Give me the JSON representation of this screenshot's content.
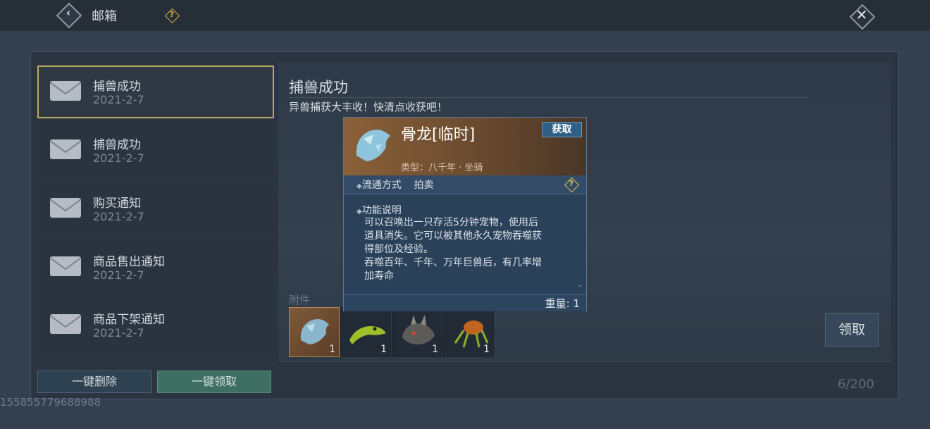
{
  "header": {
    "title": "邮箱",
    "back_icon": "chevron-left-icon",
    "help_icon": "question-diamond-icon",
    "close_icon": "close-icon"
  },
  "mail_list": [
    {
      "title": "捕兽成功",
      "date": "2021-2-7",
      "selected": true
    },
    {
      "title": "捕兽成功",
      "date": "2021-2-7",
      "selected": false
    },
    {
      "title": "购买通知",
      "date": "2021-2-7",
      "selected": false
    },
    {
      "title": "商品售出通知",
      "date": "2021-2-7",
      "selected": false
    },
    {
      "title": "商品下架通知",
      "date": "2021-2-7",
      "selected": false
    }
  ],
  "actions": {
    "delete_all": "一键删除",
    "collect_all": "一键领取",
    "collect": "领取"
  },
  "detail": {
    "title": "捕兽成功",
    "body": "异兽捕获大丰收！快清点收获吧！",
    "attachment_label": "附件",
    "attachments": [
      {
        "name": "bone-dragon-icon",
        "count": "1",
        "selected": true
      },
      {
        "name": "green-lizard-icon",
        "count": "1",
        "selected": false
      },
      {
        "name": "horned-beast-icon",
        "count": "1",
        "selected": false
      },
      {
        "name": "orange-crab-icon",
        "count": "1",
        "selected": false
      }
    ]
  },
  "capacity": "6/200",
  "watermark": "155855779688988",
  "tooltip": {
    "name": "骨龙[临时]",
    "get_button": "获取",
    "type": "类型：八千年 · 坐骑",
    "flow_label": "流通方式",
    "flow_value": "拍卖",
    "function_heading": "功能说明",
    "desc_lines": [
      "可以召唤出一只存活5分钟宠物，使用后",
      "道具消失。它可以被其他永久宠物吞噬获",
      "得部位及经验。",
      "吞噬百年、千年、万年巨兽后，有几率增",
      "加寿命"
    ],
    "weight": "重量: 1"
  },
  "colors": {
    "background": "#34404e",
    "selected_border": "#b8ab5c",
    "collect_all_button": "#3f6e62",
    "tooltip_header": "#8a6038"
  }
}
